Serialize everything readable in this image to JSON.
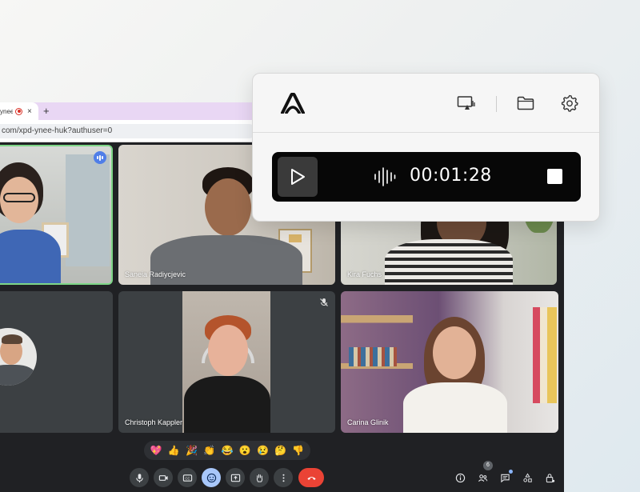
{
  "browser": {
    "tab_title": "ynee",
    "tab_close": "×",
    "new_tab": "+",
    "url": "com/xpd-ynee-huk?authuser=0",
    "tab_strip_color": "#e9d7f4"
  },
  "meeting": {
    "participants": [
      {
        "name": "",
        "speaking": true
      },
      {
        "name": "Saneia Radiycjevic"
      },
      {
        "name": "Kira Fuchs"
      },
      {
        "name": ""
      },
      {
        "name": "Christoph Kappler",
        "muted": true
      },
      {
        "name": "Carina Glinik"
      }
    ],
    "reactions": [
      "💖",
      "👍",
      "🎉",
      "👏",
      "😂",
      "😮",
      "😢",
      "🤔",
      "👎"
    ],
    "people_count": "6",
    "controls": [
      "mic-icon",
      "camera-icon",
      "captions-icon",
      "emoji-icon",
      "present-icon",
      "raise-hand-icon",
      "more-icon",
      "hangup-icon"
    ],
    "right_controls": [
      "info-icon",
      "people-icon",
      "chat-icon",
      "activities-icon",
      "host-controls-icon"
    ],
    "colors": {
      "speaking": "#7ed687",
      "hangup": "#ea4335",
      "active": "#a8c7fa"
    }
  },
  "recorder": {
    "timer": "00:01:28",
    "icons": [
      "app-logo-icon",
      "screen-share-icon",
      "folder-icon",
      "settings-icon",
      "play-icon",
      "waveform-icon",
      "stop-icon"
    ]
  }
}
